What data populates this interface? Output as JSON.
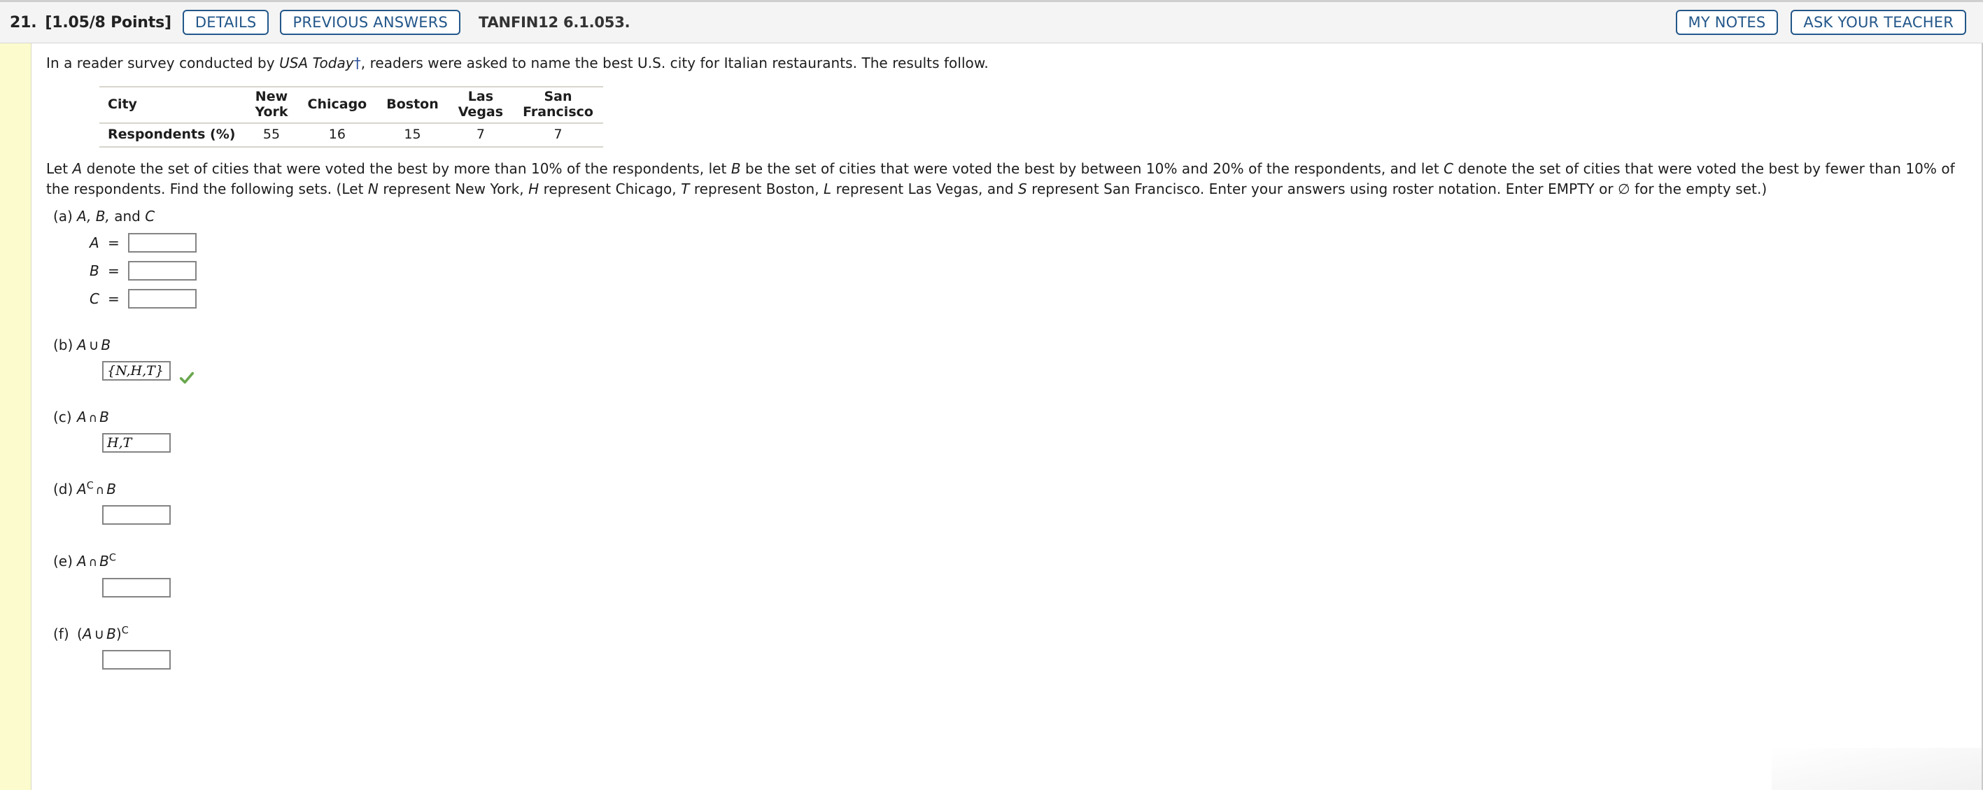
{
  "header": {
    "question_number": "21.",
    "points": "[1.05/8 Points]",
    "details_label": "DETAILS",
    "previous_answers_label": "PREVIOUS ANSWERS",
    "question_code": "TANFIN12 6.1.053.",
    "my_notes_label": "MY NOTES",
    "ask_your_teacher_label": "ASK YOUR TEACHER",
    "accent_color": "#23578a",
    "bar_color": "#f4f4f4"
  },
  "problem": {
    "intro_before_italic": "In a reader survey conducted by ",
    "intro_italic": "USA Today",
    "intro_dagger": "†",
    "intro_after_italic": ", readers were asked to name the best U.S. city for Italian restaurants. The results follow.",
    "setup_line": "Let A denote the set of cities that were voted the best by more than 10% of the respondents, let B be the set of cities that were voted the best by between 10% and 20% of the respondents, and let C denote the set of cities that were voted the best by fewer than 10% of the respondents. Find the following sets. (Let N represent New York, H represent Chicago, T represent Boston, L represent Las Vegas, and S represent San Francisco. Enter your answers using roster notation. Enter EMPTY or ∅ for the empty set.)"
  },
  "table": {
    "row_header_label": "City",
    "columns": [
      "New\nYork",
      "Chicago",
      "Boston",
      "Las\nVegas",
      "San\nFrancisco"
    ],
    "data_row_label": "Respondents (%)",
    "values": [
      "55",
      "16",
      "15",
      "7",
      "7"
    ]
  },
  "parts": [
    {
      "label": "(a)",
      "expression_html": "a-expr",
      "expr_text": "A, B, and C",
      "type": "multi",
      "fields": [
        {
          "var": "A",
          "eq": "=",
          "value": ""
        },
        {
          "var": "B",
          "eq": "=",
          "value": ""
        },
        {
          "var": "C",
          "eq": "=",
          "value": ""
        }
      ]
    },
    {
      "label": "(b)",
      "expr_text": "A ∪ B",
      "type": "single",
      "value": "{N,H,T}",
      "correct": true
    },
    {
      "label": "(c)",
      "expr_text": "A ∩ B",
      "type": "single",
      "value": "H,T",
      "correct": false
    },
    {
      "label": "(d)",
      "expr_text": "A^C ∩ B",
      "type": "single",
      "value": "",
      "correct": false
    },
    {
      "label": "(e)",
      "expr_text": "A ∩ B^C",
      "type": "single",
      "value": "",
      "correct": false
    },
    {
      "label": "(f)",
      "expr_text": "(A ∪ B)^C",
      "type": "single",
      "value": "",
      "correct": false
    }
  ],
  "symbols": {
    "union": "∪",
    "intersect": "∩",
    "complement": "C",
    "checkmark_color": "#6aa84f"
  }
}
